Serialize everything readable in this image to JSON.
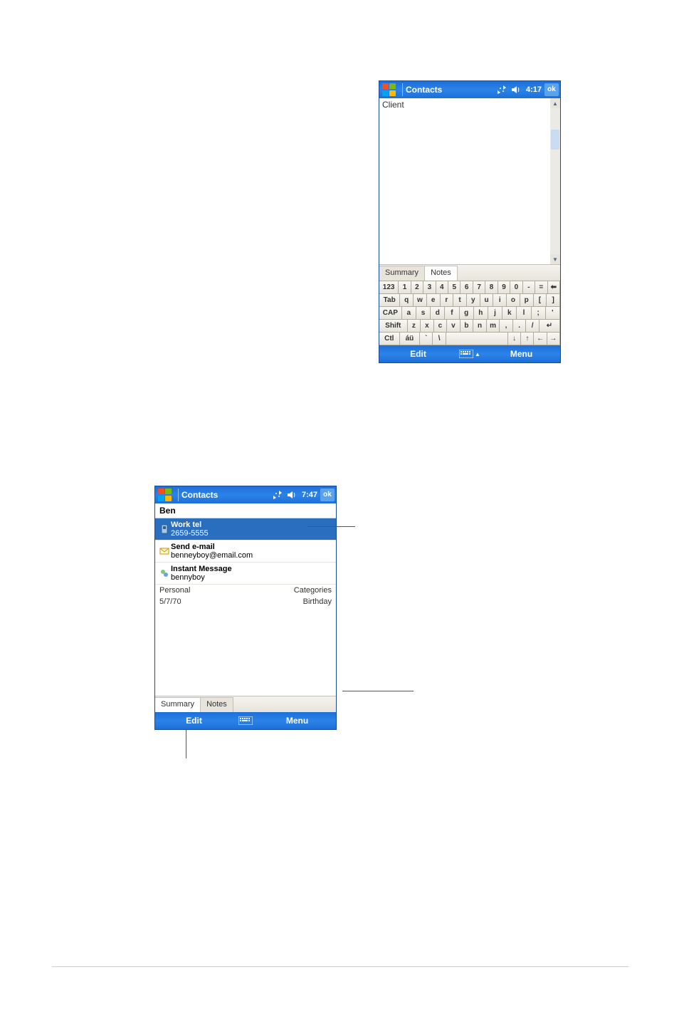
{
  "dev1": {
    "title": "Contacts",
    "time": "4:17",
    "ok": "ok",
    "client_text": "Client",
    "tabs": {
      "summary": "Summary",
      "notes": "Notes"
    },
    "kb": {
      "r1": [
        "123",
        "1",
        "2",
        "3",
        "4",
        "5",
        "6",
        "7",
        "8",
        "9",
        "0",
        "-",
        "=",
        "⬅"
      ],
      "r2": [
        "Tab",
        "q",
        "w",
        "e",
        "r",
        "t",
        "y",
        "u",
        "i",
        "o",
        "p",
        "[",
        "]"
      ],
      "r3": [
        "CAP",
        "a",
        "s",
        "d",
        "f",
        "g",
        "h",
        "j",
        "k",
        "l",
        ";",
        "'"
      ],
      "r4": [
        "Shift",
        "z",
        "x",
        "c",
        "v",
        "b",
        "n",
        "m",
        ",",
        ".",
        "/",
        "↵"
      ],
      "r5": [
        "Ctl",
        "áü",
        "`",
        "\\",
        " ",
        "↓",
        "↑",
        "←",
        "→"
      ]
    },
    "bottom": {
      "edit": "Edit",
      "menu": "Menu"
    }
  },
  "dev2": {
    "title": "Contacts",
    "time": "7:47",
    "ok": "ok",
    "name": "Ben",
    "rows": [
      {
        "t": "Work tel",
        "v": "2659-5555"
      },
      {
        "t": "Send e-mail",
        "v": "benneyboy@email.com"
      },
      {
        "t": "Instant Message",
        "v": "bennyboy"
      }
    ],
    "categories": {
      "label": "Categories",
      "value": "Personal"
    },
    "birthday": {
      "label": "Birthday",
      "value": "5/7/70"
    },
    "tabs": {
      "summary": "Summary",
      "notes": "Notes"
    },
    "bottom": {
      "edit": "Edit",
      "menu": "Menu"
    }
  }
}
